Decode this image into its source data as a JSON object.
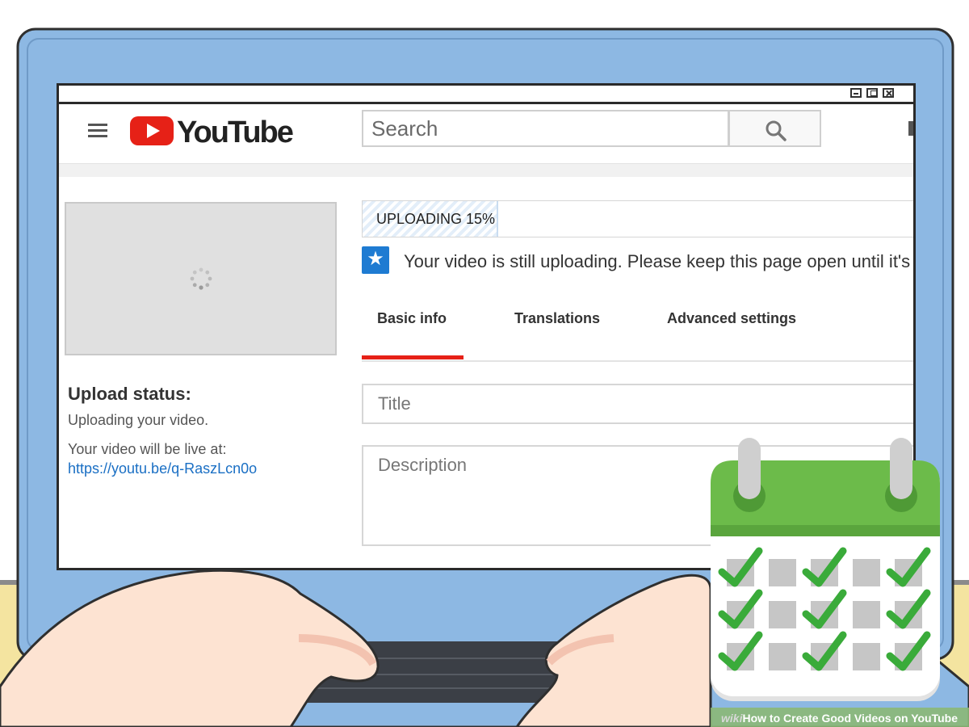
{
  "window": {
    "minimize_label": "",
    "maximize_label": "",
    "close_label": ""
  },
  "header": {
    "logo_text": "YouTube",
    "search_placeholder": "Search",
    "search_icon": "magnifier-icon",
    "menu_icon": "hamburger-icon"
  },
  "sidebar": {
    "upload_status_heading": "Upload status:",
    "upload_status_text": "Uploading your video.",
    "live_at_label": "Your video will be live at:",
    "video_url": "https://youtu.be/q-RaszLcn0o"
  },
  "upload": {
    "progress_label": "UPLOADING 15%",
    "progress_fraction": 0.15,
    "notice_text": "Your video is still uploading. Please keep this page open until it's"
  },
  "tabs": [
    {
      "label": "Basic info",
      "active": true
    },
    {
      "label": "Translations",
      "active": false
    },
    {
      "label": "Advanced settings",
      "active": false
    }
  ],
  "form": {
    "title_placeholder": "Title",
    "description_placeholder": "Description"
  },
  "overlay": {
    "icon": "calendar-check-icon",
    "caption_wiki": "wiki",
    "caption_title": "How to Create Good Videos on YouTube"
  },
  "colors": {
    "youtube_red": "#e62117",
    "link_blue": "#1a6fc4",
    "notice_blue": "#1e7bd2",
    "laptop_blue": "#8db8e3",
    "calendar_green": "#6cbb4a",
    "check_green": "#3aab3a"
  }
}
